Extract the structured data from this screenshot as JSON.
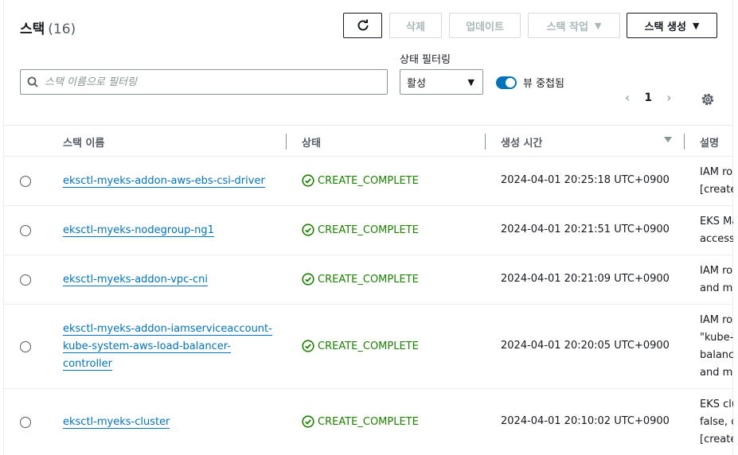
{
  "header": {
    "title": "스택",
    "count": "(16)",
    "buttons": {
      "delete": "삭제",
      "update": "업데이트",
      "stack_actions": "스택 작업",
      "create_stack": "스택 생성"
    }
  },
  "filter": {
    "search_placeholder": "스택 이름으로 필터링",
    "status_label": "상태 필터링",
    "status_value": "활성",
    "nested_view_label": "뷰 중첩됨"
  },
  "pagination": {
    "current_page": "1"
  },
  "table": {
    "columns": [
      "스택 이름",
      "상태",
      "생성 시간",
      "설명"
    ],
    "rows": [
      {
        "name_lines": [
          "eksctl-myeks-addon-aws-ebs-csi-driver"
        ],
        "status": "CREATE_COMPLETE",
        "created": "2024-04-01 20:25:18 UTC+0900",
        "desc_lines": [
          "IAM ro",
          "[create"
        ]
      },
      {
        "name_lines": [
          "eksctl-myeks-nodegroup-ng1"
        ],
        "status": "CREATE_COMPLETE",
        "created": "2024-04-01 20:21:51 UTC+0900",
        "desc_lines": [
          "EKS Ma",
          "access:"
        ]
      },
      {
        "name_lines": [
          "eksctl-myeks-addon-vpc-cni"
        ],
        "status": "CREATE_COMPLETE",
        "created": "2024-04-01 20:21:09 UTC+0900",
        "desc_lines": [
          "IAM ro",
          "and ma"
        ]
      },
      {
        "name_lines": [
          "eksctl-myeks-addon-iamserviceaccount-",
          "kube-system-aws-load-balancer-",
          "controller"
        ],
        "status": "CREATE_COMPLETE",
        "created": "2024-04-01 20:20:05 UTC+0900",
        "desc_lines": [
          "IAM ro",
          "\"kube-",
          "balanc",
          "and ma"
        ]
      },
      {
        "name_lines": [
          "eksctl-myeks-cluster"
        ],
        "status": "CREATE_COMPLETE",
        "created": "2024-04-01 20:10:02 UTC+0900",
        "desc_lines": [
          "EKS clu",
          "false, c",
          "[create"
        ]
      }
    ]
  },
  "colors": {
    "link": "#0073bb",
    "success": "#1d8102",
    "toggle": "#0073bb"
  },
  "icons": {
    "refresh": "refresh-icon",
    "search": "search-icon",
    "gear": "gear-icon",
    "status": "check-circle-icon"
  }
}
